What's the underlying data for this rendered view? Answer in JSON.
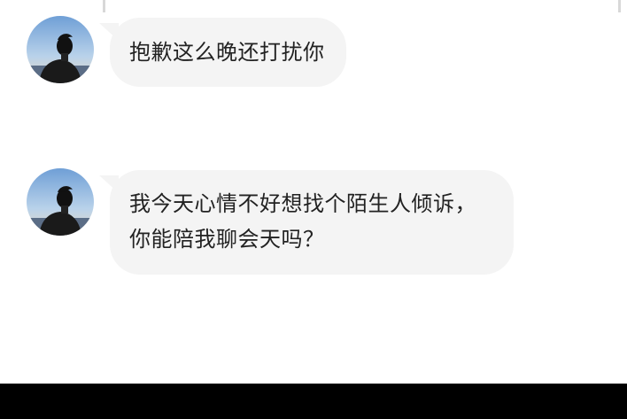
{
  "chat": {
    "messages": [
      {
        "sender_avatar": "avatar-man-back-view",
        "text": "抱歉这么晚还打扰你"
      },
      {
        "sender_avatar": "avatar-man-back-view",
        "text": "我今天心情不好想找个陌生人倾诉，你能陪我聊会天吗？"
      }
    ]
  },
  "colors": {
    "background": "#ffffff",
    "bubble": "#f4f4f4",
    "text": "#222222",
    "bottom_bar": "#000000"
  }
}
